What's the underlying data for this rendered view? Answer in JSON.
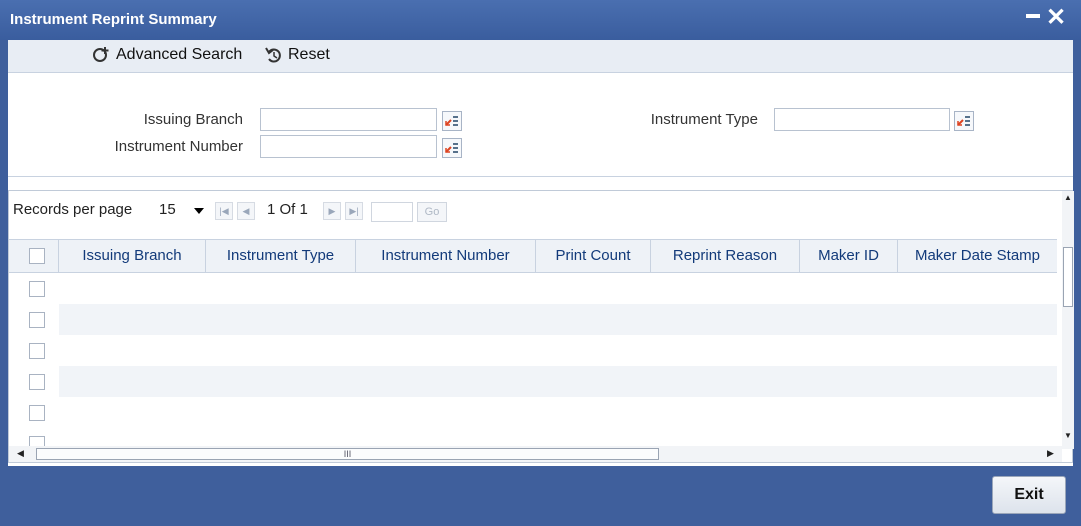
{
  "window": {
    "title": "Instrument Reprint Summary"
  },
  "toolbar": {
    "advanced_search": "Advanced Search",
    "reset": "Reset"
  },
  "search": {
    "issuing_branch_label": "Issuing Branch",
    "instrument_number_label": "Instrument Number",
    "instrument_type_label": "Instrument Type",
    "issuing_branch_value": "",
    "instrument_number_value": "",
    "instrument_type_value": ""
  },
  "pager": {
    "records_per_page_label": "Records per page",
    "records_per_page_value": "15",
    "page_info": "1 Of 1",
    "go_label": "Go"
  },
  "table": {
    "columns": [
      "Issuing Branch",
      "Instrument Type",
      "Instrument Number",
      "Print Count",
      "Reprint Reason",
      "Maker ID",
      "Maker Date Stamp"
    ],
    "rows": []
  },
  "footer": {
    "exit_label": "Exit"
  },
  "colors": {
    "titlebar": "#3a5d9e",
    "footer": "#3f5f9c",
    "header_text": "#123a7a"
  }
}
